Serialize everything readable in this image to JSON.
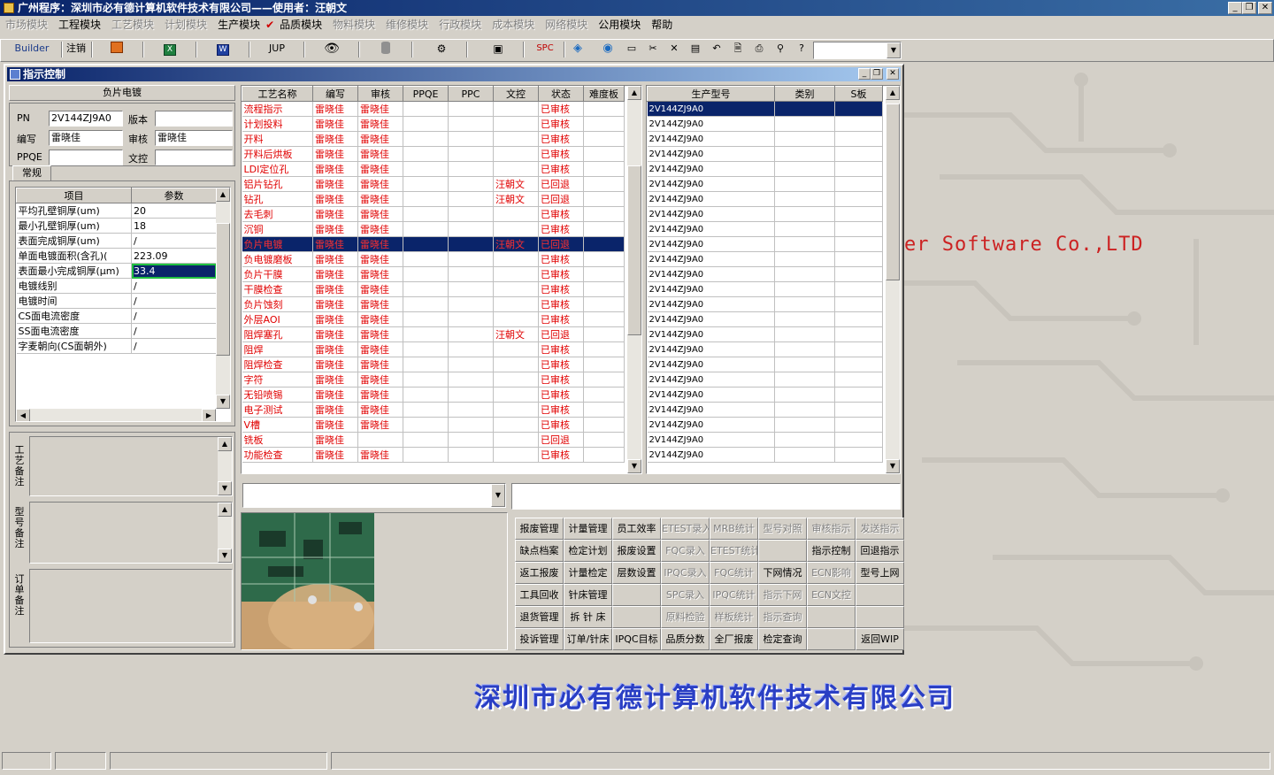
{
  "app": {
    "title": "广州程序：深圳市必有德计算机软件技术有限公司——使用者：汪朝文"
  },
  "menu": [
    {
      "label": "市场模块",
      "disabled": true
    },
    {
      "label": "工程模块",
      "disabled": false
    },
    {
      "label": "工艺模块",
      "disabled": true
    },
    {
      "label": "计划模块",
      "disabled": true
    },
    {
      "label": "生产模块",
      "disabled": false
    },
    {
      "label": "✔",
      "disabled": false
    },
    {
      "label": "品质模块",
      "disabled": false
    },
    {
      "label": "物料模块",
      "disabled": true
    },
    {
      "label": "维修模块",
      "disabled": true
    },
    {
      "label": "行政模块",
      "disabled": true
    },
    {
      "label": "成本模块",
      "disabled": true
    },
    {
      "label": "网络模块",
      "disabled": true
    },
    {
      "label": "公用模块",
      "disabled": false
    },
    {
      "label": "帮助",
      "disabled": false
    }
  ],
  "toolbar": {
    "builder": "Builder",
    "logout": "注销",
    "jup": "JUP",
    "spc": "SPC",
    "icons": [
      "powerpoint-icon",
      "excel-icon",
      "word-icon",
      "eye-icon",
      "database-icon",
      "network-icon",
      "computer-icon",
      "cube-icon",
      "globe-icon",
      "new-icon",
      "cut-icon",
      "close-icon",
      "save-icon",
      "undo-icon",
      "preview-icon",
      "print-icon",
      "find-icon",
      "help-icon"
    ]
  },
  "brand": {
    "english": "er Software Co.,LTD",
    "chinese": "深圳市必有德计算机软件技术有限公司"
  },
  "window": {
    "title": "指示控制"
  },
  "left": {
    "header": "负片电镀",
    "pn_label": "PN",
    "pn": "2V144ZJ9A0",
    "version_label": "版本",
    "version": "",
    "author_label": "编写",
    "author": "雷晓佳",
    "reviewer_label": "审核",
    "reviewer": "雷晓佳",
    "ppqe_label": "PPQE",
    "ppqe": "",
    "doc_label": "文控",
    "doc": "",
    "tab": "常规",
    "param_headers": [
      "项目",
      "参数"
    ],
    "params": [
      [
        "平均孔壁铜厚(um)",
        "20"
      ],
      [
        "最小孔壁铜厚(um)",
        "18"
      ],
      [
        "表面完成铜厚(um)",
        "/"
      ],
      [
        "单面电镀面积(含孔)(",
        "223.09"
      ],
      [
        "表面最小完成铜厚(μm)",
        "33.4"
      ],
      [
        "电镀线别",
        "/"
      ],
      [
        "电镀时间",
        "/"
      ],
      [
        "CS面电流密度",
        "/"
      ],
      [
        "SS面电流密度",
        "/"
      ],
      [
        "字麦朝向(CS面朝外)",
        "/"
      ]
    ],
    "notes": [
      "工艺备注",
      "型号备注",
      "订单备注"
    ]
  },
  "process": {
    "headers": [
      "工艺名称",
      "编写",
      "审核",
      "PPQE",
      "PPC",
      "文控",
      "状态",
      "难度板"
    ],
    "rows": [
      [
        "流程指示",
        "雷晓佳",
        "雷晓佳",
        "",
        "",
        "",
        "已审核",
        ""
      ],
      [
        "计划投料",
        "雷晓佳",
        "雷晓佳",
        "",
        "",
        "",
        "已审核",
        ""
      ],
      [
        "开料",
        "雷晓佳",
        "雷晓佳",
        "",
        "",
        "",
        "已审核",
        ""
      ],
      [
        "开料后烘板",
        "雷晓佳",
        "雷晓佳",
        "",
        "",
        "",
        "已审核",
        ""
      ],
      [
        "LDI定位孔",
        "雷晓佳",
        "雷晓佳",
        "",
        "",
        "",
        "已审核",
        ""
      ],
      [
        "铝片钻孔",
        "雷晓佳",
        "雷晓佳",
        "",
        "",
        "汪朝文",
        "已回退",
        ""
      ],
      [
        "钻孔",
        "雷晓佳",
        "雷晓佳",
        "",
        "",
        "汪朝文",
        "已回退",
        ""
      ],
      [
        "去毛刺",
        "雷晓佳",
        "雷晓佳",
        "",
        "",
        "",
        "已审核",
        ""
      ],
      [
        "沉铜",
        "雷晓佳",
        "雷晓佳",
        "",
        "",
        "",
        "已审核",
        ""
      ],
      [
        "负片电镀",
        "雷晓佳",
        "雷晓佳",
        "",
        "",
        "汪朝文",
        "已回退",
        ""
      ],
      [
        "负电镀磨板",
        "雷晓佳",
        "雷晓佳",
        "",
        "",
        "",
        "已审核",
        ""
      ],
      [
        "负片干膜",
        "雷晓佳",
        "雷晓佳",
        "",
        "",
        "",
        "已审核",
        ""
      ],
      [
        "干膜检查",
        "雷晓佳",
        "雷晓佳",
        "",
        "",
        "",
        "已审核",
        ""
      ],
      [
        "负片蚀刻",
        "雷晓佳",
        "雷晓佳",
        "",
        "",
        "",
        "已审核",
        ""
      ],
      [
        "外层AOI",
        "雷晓佳",
        "雷晓佳",
        "",
        "",
        "",
        "已审核",
        ""
      ],
      [
        "阻焊塞孔",
        "雷晓佳",
        "雷晓佳",
        "",
        "",
        "汪朝文",
        "已回退",
        ""
      ],
      [
        "阻焊",
        "雷晓佳",
        "雷晓佳",
        "",
        "",
        "",
        "已审核",
        ""
      ],
      [
        "阻焊检查",
        "雷晓佳",
        "雷晓佳",
        "",
        "",
        "",
        "已审核",
        ""
      ],
      [
        "字符",
        "雷晓佳",
        "雷晓佳",
        "",
        "",
        "",
        "已审核",
        ""
      ],
      [
        "无铅喷锡",
        "雷晓佳",
        "雷晓佳",
        "",
        "",
        "",
        "已审核",
        ""
      ],
      [
        "电子测试",
        "雷晓佳",
        "雷晓佳",
        "",
        "",
        "",
        "已审核",
        ""
      ],
      [
        "V槽",
        "雷晓佳",
        "雷晓佳",
        "",
        "",
        "",
        "已审核",
        ""
      ],
      [
        "铣板",
        "雷晓佳",
        "",
        "",
        "",
        "",
        "已回退",
        ""
      ],
      [
        "功能检查",
        "雷晓佳",
        "雷晓佳",
        "",
        "",
        "",
        "已审核",
        ""
      ]
    ],
    "selected_index": 9
  },
  "models": {
    "headers": [
      "生产型号",
      "类别",
      "S板"
    ],
    "rows": [
      "2V144ZJ9A0",
      "2V144ZJ9A0",
      "2V144ZJ9A0",
      "2V144ZJ9A0",
      "2V144ZJ9A0",
      "2V144ZJ9A0",
      "2V144ZJ9A0",
      "2V144ZJ9A0",
      "2V144ZJ9A0",
      "2V144ZJ9A0",
      "2V144ZJ9A0",
      "2V144ZJ9A0",
      "2V144ZJ9A0",
      "2V144ZJ9A0",
      "2V144ZJ9A0",
      "2V144ZJ9A0",
      "2V144ZJ9A0",
      "2V144ZJ9A0",
      "2V144ZJ9A0",
      "2V144ZJ9A0",
      "2V144ZJ9A0",
      "2V144ZJ9A0",
      "2V144ZJ9A0",
      "2V144ZJ9A0"
    ],
    "selected_index": 0
  },
  "buttons": [
    [
      {
        "t": "报废管理",
        "d": false
      },
      {
        "t": "计量管理",
        "d": false
      },
      {
        "t": "员工效率",
        "d": false
      },
      {
        "t": "ETEST录入",
        "d": true
      },
      {
        "t": "MRB统计",
        "d": true
      },
      {
        "t": "型号对照",
        "d": true
      },
      {
        "t": "审核指示",
        "d": true
      },
      {
        "t": "发送指示",
        "d": true
      }
    ],
    [
      {
        "t": "缺点档案",
        "d": false
      },
      {
        "t": "检定计划",
        "d": false
      },
      {
        "t": "报废设置",
        "d": false
      },
      {
        "t": "FQC录入",
        "d": true
      },
      {
        "t": "ETEST统计",
        "d": true
      },
      {
        "t": "",
        "d": true
      },
      {
        "t": "指示控制",
        "d": false
      },
      {
        "t": "回退指示",
        "d": false
      }
    ],
    [
      {
        "t": "返工报废",
        "d": false
      },
      {
        "t": "计量检定",
        "d": false
      },
      {
        "t": "层数设置",
        "d": false
      },
      {
        "t": "IPQC录入",
        "d": true
      },
      {
        "t": "FQC统计",
        "d": true
      },
      {
        "t": "下网情况",
        "d": false
      },
      {
        "t": "ECN影响",
        "d": true
      },
      {
        "t": "型号上网",
        "d": false
      }
    ],
    [
      {
        "t": "工具回收",
        "d": false
      },
      {
        "t": "针床管理",
        "d": false
      },
      {
        "t": "",
        "d": true
      },
      {
        "t": "SPC录入",
        "d": true
      },
      {
        "t": "IPQC统计",
        "d": true
      },
      {
        "t": "指示下网",
        "d": true
      },
      {
        "t": "ECN文控",
        "d": true
      },
      {
        "t": "",
        "d": true
      }
    ],
    [
      {
        "t": "退货管理",
        "d": false
      },
      {
        "t": "拆 针 床",
        "d": false
      },
      {
        "t": "",
        "d": true
      },
      {
        "t": "原料检验",
        "d": true
      },
      {
        "t": "样板统计",
        "d": true
      },
      {
        "t": "指示查询",
        "d": true
      },
      {
        "t": "",
        "d": true
      },
      {
        "t": "",
        "d": true
      }
    ],
    [
      {
        "t": "投诉管理",
        "d": false
      },
      {
        "t": "订单/针床",
        "d": false
      },
      {
        "t": "IPQC目标",
        "d": false
      },
      {
        "t": "品质分数",
        "d": false
      },
      {
        "t": "全厂报废",
        "d": false
      },
      {
        "t": "检定查询",
        "d": false
      },
      {
        "t": "",
        "d": true
      },
      {
        "t": "返回WIP",
        "d": false
      }
    ]
  ],
  "colors": {
    "title": "#0a246a",
    "accent": "#e00000",
    "desk": "#d4d0c8"
  }
}
